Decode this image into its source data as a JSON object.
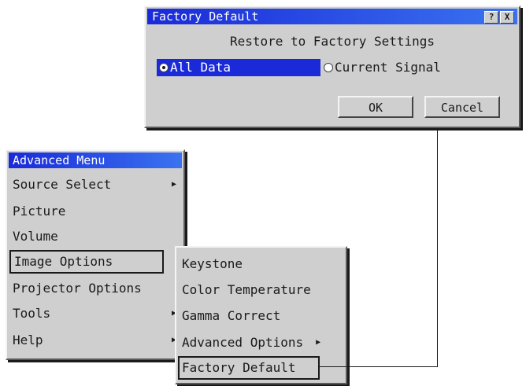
{
  "dialog": {
    "title": "Factory Default",
    "help_button": "?",
    "close_button": "X",
    "heading": "Restore to Factory Settings",
    "options": [
      {
        "label": "All Data",
        "selected": true
      },
      {
        "label": "Current Signal",
        "selected": false
      }
    ],
    "ok_label": "OK",
    "cancel_label": "Cancel"
  },
  "menu": {
    "title": "Advanced Menu",
    "items": [
      {
        "label": "Source Select",
        "has_submenu": true
      },
      {
        "label": "Picture",
        "has_submenu": false
      },
      {
        "label": "Volume",
        "has_submenu": false
      },
      {
        "label": "Image Options",
        "has_submenu": true,
        "highlighted": true
      },
      {
        "label": "Projector Options",
        "has_submenu": true
      },
      {
        "label": "Tools",
        "has_submenu": true
      },
      {
        "label": "Help",
        "has_submenu": true
      }
    ]
  },
  "submenu": {
    "items": [
      {
        "label": "Keystone",
        "has_submenu": false
      },
      {
        "label": "Color Temperature",
        "has_submenu": false
      },
      {
        "label": "Gamma Correct",
        "has_submenu": false
      },
      {
        "label": "Advanced Options",
        "has_submenu": true
      },
      {
        "label": "Factory Default",
        "has_submenu": false,
        "highlighted": true
      }
    ]
  },
  "icons": {
    "submenu_arrow": "triangle-right-icon"
  },
  "colors": {
    "titlebar": "#1a2ad8",
    "panel": "#cfcfcf",
    "selection": "#1a2ad8"
  }
}
